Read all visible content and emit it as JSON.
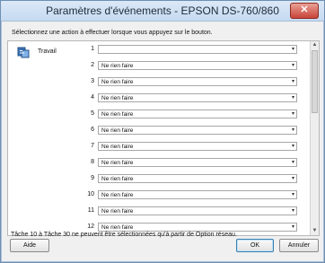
{
  "window": {
    "title": "Paramètres d'événements - EPSON DS-760/860",
    "close_label": "✕"
  },
  "instruction": "Sélectionnez une action à effectuer lorsque vous appuyez sur le bouton.",
  "task": {
    "label": "Travail"
  },
  "rows": [
    {
      "num": "1",
      "value": ""
    },
    {
      "num": "2",
      "value": "Ne rien faire"
    },
    {
      "num": "3",
      "value": "Ne rien faire"
    },
    {
      "num": "4",
      "value": "Ne rien faire"
    },
    {
      "num": "5",
      "value": "Ne rien faire"
    },
    {
      "num": "6",
      "value": "Ne rien faire"
    },
    {
      "num": "7",
      "value": "Ne rien faire"
    },
    {
      "num": "8",
      "value": "Ne rien faire"
    },
    {
      "num": "9",
      "value": "Ne rien faire"
    },
    {
      "num": "10",
      "value": "Ne rien faire"
    },
    {
      "num": "11",
      "value": "Ne rien faire"
    },
    {
      "num": "12",
      "value": "Ne rien faire"
    }
  ],
  "note": "Tâche 10 à Tâche 30 ne peuvent être sélectionnées qu'à partir de Option réseau.",
  "buttons": {
    "help": "Aide",
    "ok": "OK",
    "cancel": "Annuler"
  },
  "icons": {
    "task": "scanner-task-icon",
    "dropdown": "chevron-down-icon"
  },
  "colors": {
    "accent": "#3c7fb1",
    "titlebar": "#c6daf1"
  }
}
